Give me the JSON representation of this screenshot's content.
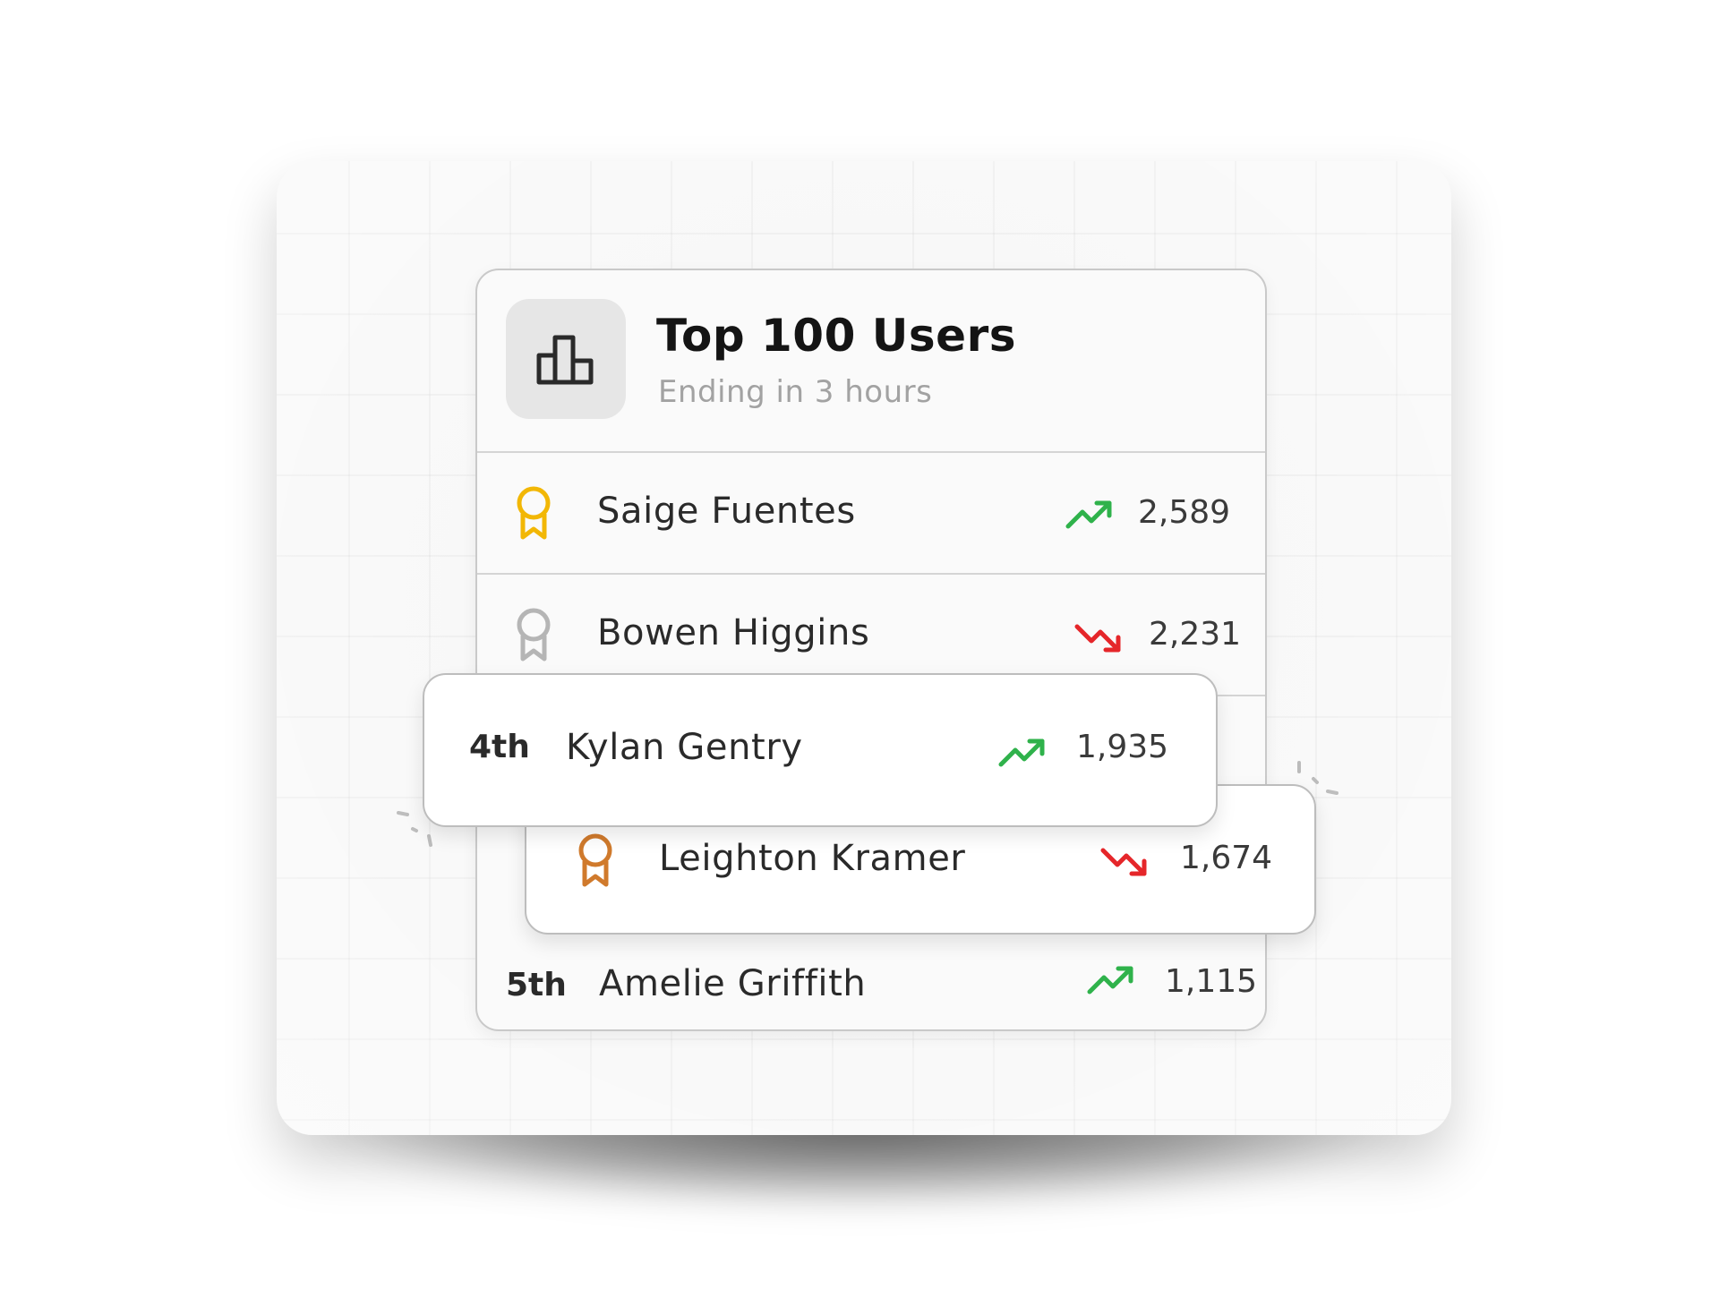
{
  "leaderboard": {
    "title": "Top 100 Users",
    "subtitle": "Ending in 3 hours",
    "header_icon": "bar-chart-icon",
    "rows": [
      {
        "badge": "medal-gold-icon",
        "name": "Saige Fuentes",
        "trend": "up",
        "score": "2,589"
      },
      {
        "badge": "medal-silver-icon",
        "name": "Bowen Higgins",
        "trend": "down",
        "score": "2,231"
      },
      {
        "rank": "4th",
        "name": "Kylan Gentry",
        "trend": "up",
        "score": "1,935"
      },
      {
        "badge": "medal-bronze-icon",
        "name": "Leighton Kramer",
        "trend": "down",
        "score": "1,674"
      },
      {
        "rank": "5th",
        "name": "Amelie Griffith",
        "trend": "up",
        "score": "1,115"
      }
    ]
  },
  "colors": {
    "gold": "#f2b705",
    "silver": "#b5b5b5",
    "bronze": "#d07a2c",
    "trend_up": "#2fb24b",
    "trend_down": "#e5262a"
  }
}
